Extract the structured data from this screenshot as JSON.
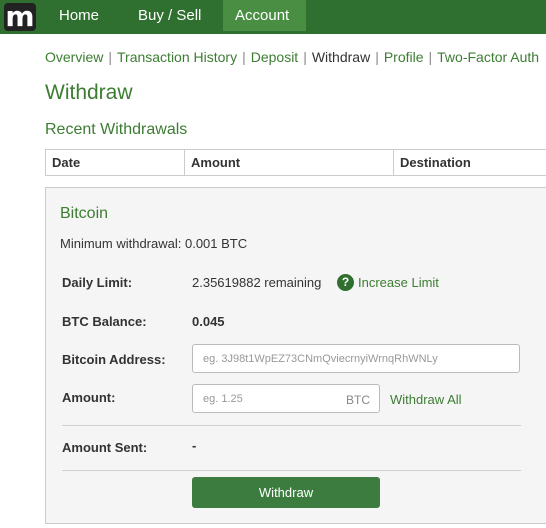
{
  "topnav": {
    "logo_letter": "m",
    "items": [
      {
        "label": "Home"
      },
      {
        "label": "Buy / Sell"
      },
      {
        "label": "Account"
      }
    ]
  },
  "subnav": {
    "items": [
      {
        "label": "Overview"
      },
      {
        "label": "Transaction History"
      },
      {
        "label": "Deposit"
      },
      {
        "label": "Withdraw"
      },
      {
        "label": "Profile"
      },
      {
        "label": "Two-Factor Auth"
      }
    ],
    "separator": "|"
  },
  "page_title": "Withdraw",
  "recent": {
    "title": "Recent Withdrawals",
    "columns": [
      "Date",
      "Amount",
      "Destination"
    ]
  },
  "bitcoin": {
    "title": "Bitcoin",
    "min_note": "Minimum withdrawal: 0.001 BTC",
    "daily_limit": {
      "label": "Daily Limit:",
      "value": "2.35619882 remaining",
      "help_icon": "?",
      "increase_link": "Increase Limit"
    },
    "balance": {
      "label": "BTC Balance:",
      "value": "0.045"
    },
    "address": {
      "label": "Bitcoin Address:",
      "placeholder": "eg. 3J98t1WpEZ73CNmQviecrnyiWrnqRhWNLy"
    },
    "amount": {
      "label": "Amount:",
      "placeholder": "eg. 1.25",
      "unit": "BTC",
      "withdraw_all": "Withdraw All"
    },
    "sent": {
      "label": "Amount Sent:",
      "value": "-"
    },
    "submit_label": "Withdraw"
  },
  "colors": {
    "nav_bg": "#2f6f2f",
    "nav_active": "#4a8e44",
    "accent_text": "#3c7d32",
    "button": "#3c7d3f"
  }
}
